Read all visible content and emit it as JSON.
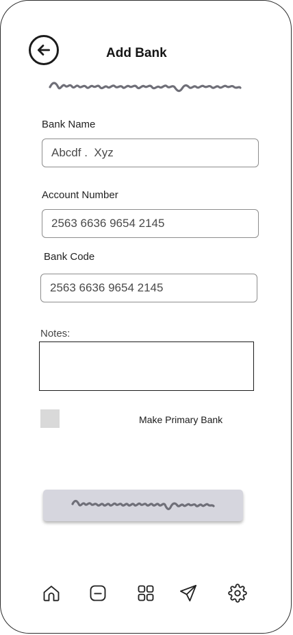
{
  "header": {
    "title": "Add Bank",
    "back_icon": "arrow-left-circle-icon"
  },
  "form": {
    "bank_name_label": "Bank Name",
    "bank_name_value": "Abcdf .  Xyz",
    "account_number_label": "Account Number",
    "account_number_value": "2563 6636 9654 2145",
    "bank_code_label": "Bank Code",
    "bank_code_value": "2563 6636 9654 2145",
    "notes_label": "Notes:",
    "notes_value": "",
    "primary_checkbox_checked": false,
    "primary_checkbox_label": "Make Primary Bank"
  },
  "bottom_nav": {
    "items": [
      {
        "icon": "home-icon"
      },
      {
        "icon": "wallet-icon"
      },
      {
        "icon": "grid-icon"
      },
      {
        "icon": "send-icon"
      },
      {
        "icon": "settings-gear-icon"
      }
    ]
  },
  "colors": {
    "scribble": "#6f6f78",
    "button_bg": "#d6d6de",
    "checkbox_bg": "#d9d9d9"
  }
}
